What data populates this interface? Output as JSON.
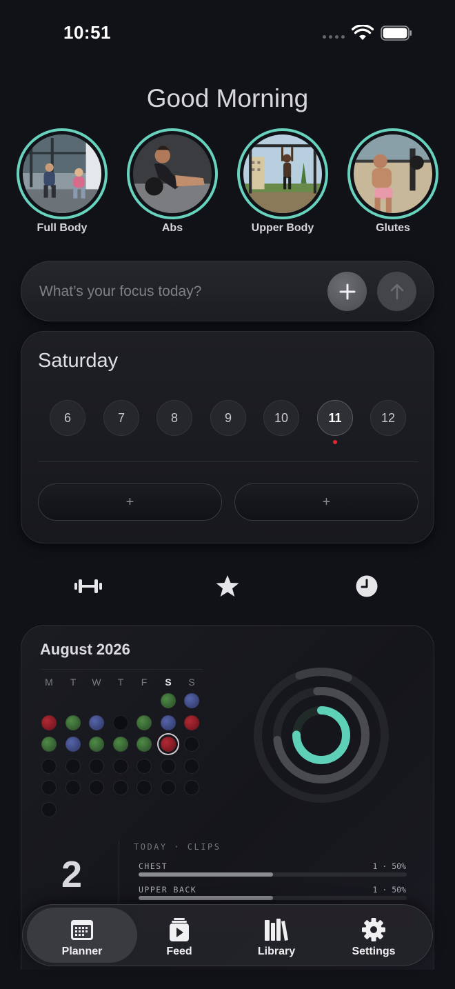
{
  "status": {
    "time": "10:51"
  },
  "greeting": "Good Morning",
  "stories": [
    {
      "label": "Full Body",
      "icon": "workout-thumbnail"
    },
    {
      "label": "Abs",
      "icon": "workout-thumbnail"
    },
    {
      "label": "Upper Body",
      "icon": "workout-thumbnail"
    },
    {
      "label": "Glutes",
      "icon": "workout-thumbnail"
    }
  ],
  "focus": {
    "placeholder": "What’s your focus today?"
  },
  "week": {
    "day_name": "Saturday",
    "days": [
      "6",
      "7",
      "8",
      "9",
      "10",
      "11",
      "12"
    ],
    "active_day": "11",
    "slot_labels": [
      "+",
      "+"
    ]
  },
  "mini_tabs": [
    "dumbbell-icon",
    "star-icon",
    "clock-icon"
  ],
  "calendar": {
    "title": "August 2026",
    "weekdays": [
      "M",
      "T",
      "W",
      "T",
      "F",
      "S",
      "S"
    ],
    "highlight_weekday": "S",
    "weeks": [
      [
        "none",
        "none",
        "none",
        "none",
        "none",
        "green",
        "blue"
      ],
      [
        "red",
        "green",
        "blue",
        "dark",
        "green",
        "blue",
        "red"
      ],
      [
        "green",
        "blue",
        "green",
        "green",
        "green",
        "today-red",
        "empty"
      ],
      [
        "empty",
        "empty",
        "empty",
        "empty",
        "empty",
        "empty",
        "empty"
      ],
      [
        "empty",
        "empty",
        "empty",
        "empty",
        "empty",
        "empty",
        "empty"
      ],
      [
        "empty",
        "none",
        "none",
        "none",
        "none",
        "none",
        "none"
      ]
    ],
    "accent": "#67d2bd"
  },
  "today": {
    "count": "2",
    "heading": "TODAY · CLIPS",
    "muscles": [
      {
        "name": "CHEST",
        "value": "1 · 50%",
        "fraction": 0.5
      },
      {
        "name": "UPPER BACK",
        "value": "1 · 50%",
        "fraction": 0.5
      }
    ]
  },
  "nav": [
    {
      "label": "Planner",
      "icon": "calendar-icon",
      "active": true
    },
    {
      "label": "Feed",
      "icon": "play-icon",
      "active": false
    },
    {
      "label": "Library",
      "icon": "books-icon",
      "active": false
    },
    {
      "label": "Settings",
      "icon": "gear-icon",
      "active": false
    }
  ]
}
